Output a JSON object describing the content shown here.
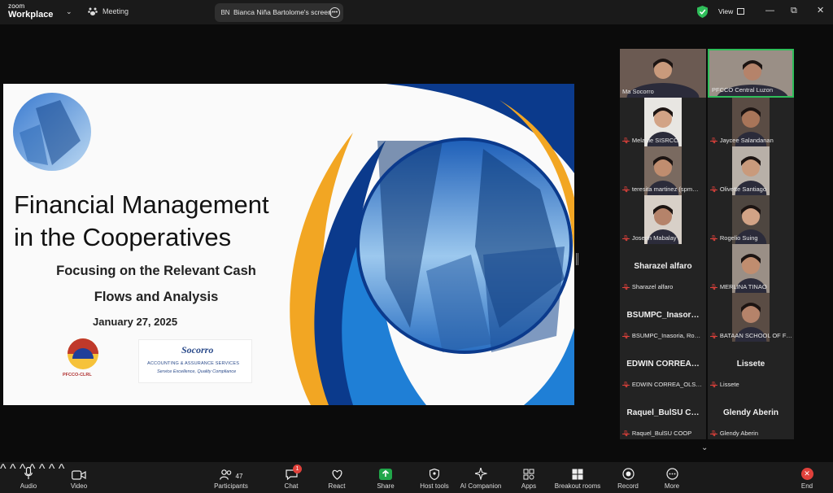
{
  "topbar": {
    "brand_top": "zoom",
    "brand_bottom": "Workplace",
    "meeting_label": "Meeting",
    "screen_initials": "BN",
    "screen_label": "Bianca Niña Bartolome's screen",
    "view_label": "View",
    "minimize": "—",
    "restore": "⧉",
    "close": "✕"
  },
  "slide": {
    "title_line1": "Financial Management",
    "title_line2": "in the Cooperatives",
    "subtitle_line1": "Focusing on the Relevant Cash",
    "subtitle_line2": "Flows and Analysis",
    "date": "January 27, 2025",
    "logo1_text": "PFCCO-CLRL",
    "logo2_name": "Socorro",
    "logo2_sub": "ACCOUNTING & ASSURANCE SERVICES",
    "logo2_tagline": "Service Excellence, Quality Compliance"
  },
  "gallery": [
    {
      "name": "Ma Socorro",
      "muted": false,
      "video": true,
      "active": false
    },
    {
      "name": "PFCCO Central Luzon",
      "muted": false,
      "video": true,
      "active": true
    },
    {
      "name": "Melanie SISRCC",
      "muted": true,
      "video": true
    },
    {
      "name": "Jaycee Salandanan",
      "muted": true,
      "video": true
    },
    {
      "name": "teresita martinez (spm…",
      "muted": true,
      "video": true
    },
    {
      "name": "Olivette Santiago",
      "muted": true,
      "video": true
    },
    {
      "name": "Joseph Mabalay",
      "muted": true,
      "video": true
    },
    {
      "name": "Rogelio Suing",
      "muted": true,
      "video": true
    },
    {
      "name": "Sharazel alfaro",
      "display": "Sharazel alfaro",
      "muted": true,
      "video": false
    },
    {
      "name": "MERLINA TINAO",
      "muted": true,
      "video": true
    },
    {
      "name": "BSUMPC_Inasoria, Ro…",
      "display": "BSUMPC_Inasor…",
      "muted": true,
      "video": false
    },
    {
      "name": "BATAAN SCHOOL OF F…",
      "muted": true,
      "video": true
    },
    {
      "name": "EDWIN CORREA_OLS…",
      "display": "EDWIN  CORREA…",
      "muted": true,
      "video": false
    },
    {
      "name": "Lissete",
      "display": "Lissete",
      "muted": true,
      "video": false
    },
    {
      "name": "Raquel_BulSU COOP",
      "display": "Raquel_BulSU  C…",
      "muted": true,
      "video": false
    },
    {
      "name": "Glendy Aberin",
      "display": "Glendy Aberin",
      "muted": true,
      "video": false
    }
  ],
  "toolbar": {
    "audio": "Audio",
    "video": "Video",
    "participants": "Participants",
    "participants_count": "47",
    "chat": "Chat",
    "chat_badge": "1",
    "react": "React",
    "share": "Share",
    "host_tools": "Host tools",
    "ai_companion": "AI Companion",
    "apps": "Apps",
    "breakout": "Breakout rooms",
    "record": "Record",
    "more": "More",
    "end": "End"
  },
  "colors": {
    "accent_green": "#2fbe5a",
    "share_green": "#21a64a",
    "end_red": "#e0413b",
    "slide_navy": "#0b3a8c",
    "slide_blue": "#1f7fd6",
    "slide_gold": "#f2a623"
  }
}
